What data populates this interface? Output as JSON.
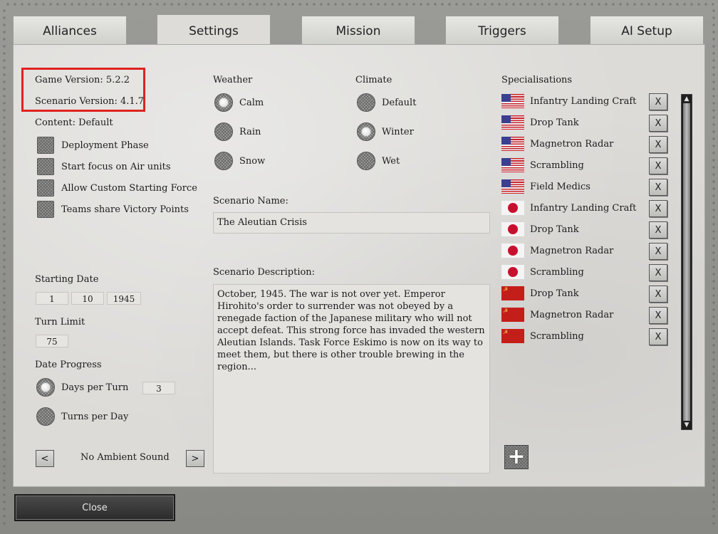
{
  "tabs": [
    "Alliances",
    "Settings",
    "Mission",
    "Triggers",
    "AI Setup"
  ],
  "active_tab": "Settings",
  "game_version": "Game Version: 5.2.2",
  "scenario_version": "Scenario Version: 4.1.7",
  "content": "Content: Default",
  "options": [
    {
      "label": "Deployment Phase",
      "checked": false
    },
    {
      "label": "Start focus on Air units",
      "checked": false
    },
    {
      "label": "Allow Custom Starting Force",
      "checked": false
    },
    {
      "label": "Teams share Victory Points",
      "checked": false
    }
  ],
  "starting_date": {
    "label": "Starting Date",
    "day": "1",
    "month": "10",
    "year": "1945"
  },
  "turn_limit": {
    "label": "Turn Limit",
    "value": "75"
  },
  "date_progress": {
    "label": "Date Progress",
    "options": [
      {
        "label": "Days per Turn",
        "selected": true,
        "value": "3"
      },
      {
        "label": "Turns per Day",
        "selected": false
      }
    ]
  },
  "ambient_sound": {
    "prev": "<",
    "label": "No Ambient Sound",
    "next": ">"
  },
  "weather": {
    "label": "Weather",
    "options": [
      {
        "label": "Calm",
        "selected": true
      },
      {
        "label": "Rain",
        "selected": false
      },
      {
        "label": "Snow",
        "selected": false
      }
    ]
  },
  "climate": {
    "label": "Climate",
    "options": [
      {
        "label": "Default",
        "selected": false
      },
      {
        "label": "Winter",
        "selected": true
      },
      {
        "label": "Wet",
        "selected": false
      }
    ]
  },
  "scenario_name": {
    "label": "Scenario Name:",
    "value": "The Aleutian Crisis"
  },
  "scenario_description": {
    "label": "Scenario Description:",
    "value": "October, 1945.  The war is not over yet.  Emperor Hirohito's order to surrender was not obeyed by a renegade faction of the Japanese military who will not accept defeat.  This strong force has invaded the western Aleutian Islands.  Task Force Eskimo is now on its way to meet them, but there is other trouble brewing in the region..."
  },
  "specialisations": {
    "label": "Specialisations",
    "remove_label": "X",
    "items": [
      {
        "flag": "us",
        "name": "Infantry Landing Craft"
      },
      {
        "flag": "us",
        "name": "Drop Tank"
      },
      {
        "flag": "us",
        "name": "Magnetron Radar"
      },
      {
        "flag": "us",
        "name": "Scrambling"
      },
      {
        "flag": "us",
        "name": "Field Medics"
      },
      {
        "flag": "jp",
        "name": "Infantry Landing Craft"
      },
      {
        "flag": "jp",
        "name": "Drop Tank"
      },
      {
        "flag": "jp",
        "name": "Magnetron Radar"
      },
      {
        "flag": "jp",
        "name": "Scrambling"
      },
      {
        "flag": "su",
        "name": "Drop Tank"
      },
      {
        "flag": "su",
        "name": "Magnetron Radar"
      },
      {
        "flag": "su",
        "name": "Scrambling"
      }
    ],
    "add_label": "+"
  },
  "close_label": "Close",
  "colors": {
    "highlight": "#e0221f",
    "panel": "#dcdbd8"
  }
}
